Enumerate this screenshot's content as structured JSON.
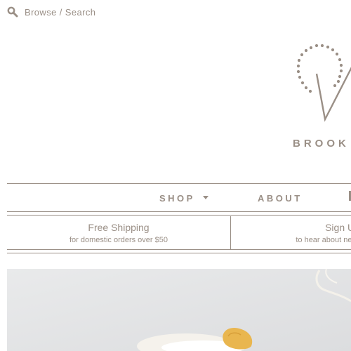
{
  "header": {
    "search_label": "Browse / Search",
    "search_icon": "search-icon",
    "brand_name_visible": "BROOK"
  },
  "nav": {
    "shop": "SHOP",
    "about": "ABOUT"
  },
  "promos": {
    "shipping_title": "Free Shipping",
    "shipping_sub": "for domestic orders over $50",
    "signup_title": "Sign Up",
    "signup_sub": "to hear about new products"
  },
  "colors": {
    "accent": "#9a8f86",
    "background": "#ffffff",
    "hero_bg": "#e4e5e6",
    "cookie": "#e9b64f"
  }
}
